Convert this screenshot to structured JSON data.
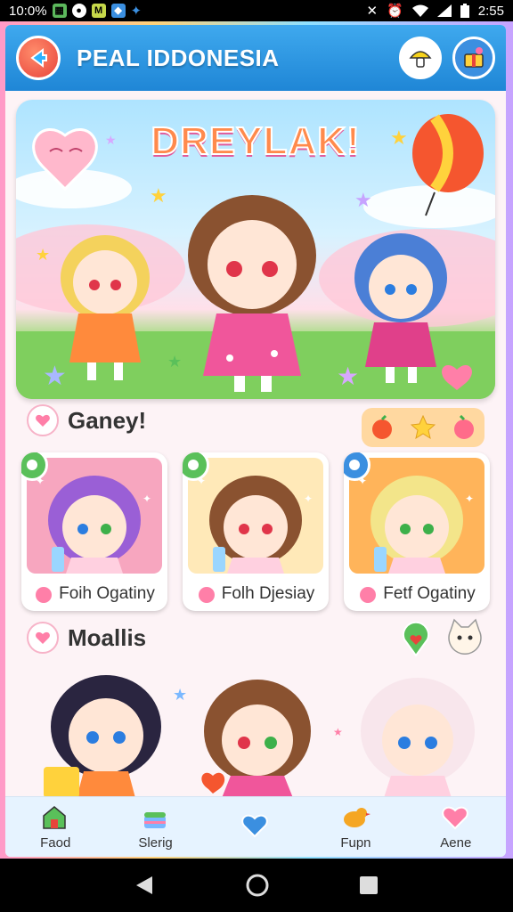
{
  "status_bar": {
    "time_left": "10:0%",
    "time_right": "2:55",
    "m_icon": "M"
  },
  "header": {
    "title": "PEAL IDDONESIA"
  },
  "hero": {
    "title": "DREYLAK!"
  },
  "section1": {
    "title": "Ganey!"
  },
  "cards": [
    {
      "label": "Foih Ogatiny",
      "bg": "#f7a6bf",
      "hair": "#9a5fd6",
      "eyes": [
        "#2b7de0",
        "#3db04a"
      ],
      "tag_color": "#5ac05a"
    },
    {
      "label": "Folh Djesiay",
      "bg": "#ffe9b8",
      "hair": "#8a5230",
      "eyes": [
        "#e0354a",
        "#e0354a"
      ],
      "tag_color": "#5ac05a"
    },
    {
      "label": "Fetf Ogatiny",
      "bg": "#ffb45a",
      "hair": "#f3e58a",
      "eyes": [
        "#3db04a",
        "#3db04a"
      ],
      "tag_color": "#3b8fe0"
    }
  ],
  "section2": {
    "title": "Moallis"
  },
  "nav": [
    {
      "label": "Faod",
      "icon": "house-icon"
    },
    {
      "label": "Slerig",
      "icon": "cake-icon"
    },
    {
      "label": "",
      "icon": "heart-icon"
    },
    {
      "label": "Fupn",
      "icon": "bird-icon"
    },
    {
      "label": "Aene",
      "icon": "heart-icon"
    }
  ],
  "colors": {
    "header": "#1f86d6",
    "accent": "#e8443b",
    "nav_bg": "#e6f3ff"
  }
}
